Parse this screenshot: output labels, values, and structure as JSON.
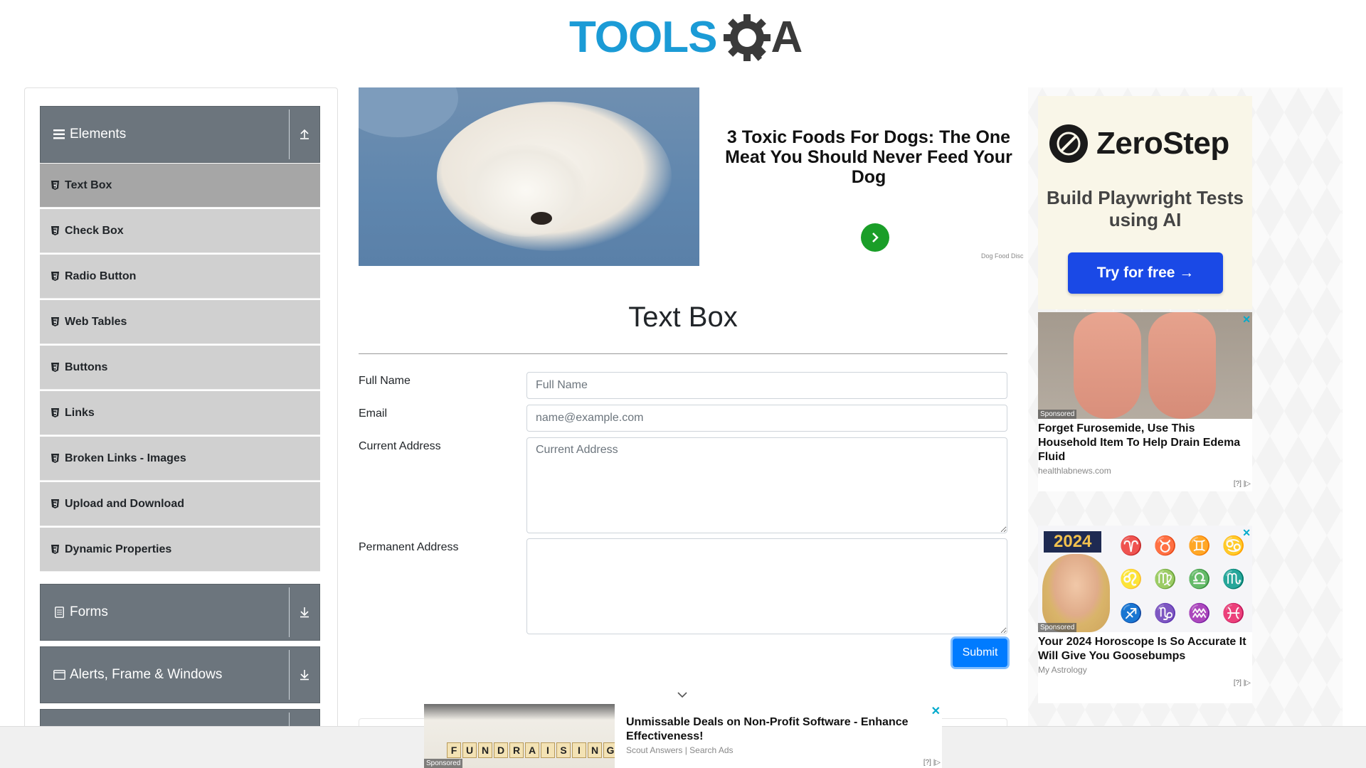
{
  "header": {
    "logo_text": "TOOLS",
    "logo_letter": "A"
  },
  "sidebar": {
    "groups": [
      {
        "label": "Elements",
        "icon": "hamburger-icon",
        "toggle_icon": "collapse-up-icon"
      },
      {
        "label": "Forms",
        "icon": "form-icon",
        "toggle_icon": "expand-down-icon"
      },
      {
        "label": "Alerts, Frame & Windows",
        "icon": "window-icon",
        "toggle_icon": "expand-down-icon"
      }
    ],
    "items": [
      {
        "label": "Text Box",
        "active": true
      },
      {
        "label": "Check Box"
      },
      {
        "label": "Radio Button"
      },
      {
        "label": "Web Tables"
      },
      {
        "label": "Buttons"
      },
      {
        "label": "Links"
      },
      {
        "label": "Broken Links - Images"
      },
      {
        "label": "Upload and Download"
      },
      {
        "label": "Dynamic Properties"
      }
    ]
  },
  "top_ad": {
    "headline": "3 Toxic Foods For Dogs: The One Meat You Should Never Feed Your Dog",
    "source": "Dog Food Disc"
  },
  "page": {
    "title": "Text Box"
  },
  "form": {
    "full_name": {
      "label": "Full Name",
      "placeholder": "Full Name",
      "value": ""
    },
    "email": {
      "label": "Email",
      "placeholder": "name@example.com",
      "value": ""
    },
    "current_address": {
      "label": "Current Address",
      "placeholder": "Current Address",
      "value": ""
    },
    "permanent_address": {
      "label": "Permanent Address",
      "placeholder": "",
      "value": ""
    },
    "submit_label": "Submit"
  },
  "right_ads": {
    "zerostep": {
      "brand": "ZeroStep",
      "tagline": "Build Playwright Tests using AI",
      "cta": "Try for free →"
    },
    "ad1": {
      "badge": "Sponsored",
      "title": "Forget Furosemide, Use This Household Item To Help Drain Edema Fluid",
      "source": "healthlabnews.com",
      "meta": "[?] |▷"
    },
    "ad2": {
      "badge": "Sponsored",
      "year": "2024",
      "title": "Your 2024 Horoscope Is So Accurate It Will Give You Goosebumps",
      "source": "My Astrology",
      "meta": "[?] |▷",
      "sign_labels": [
        "Aries",
        "Taurus",
        "Gemini",
        "Cancer",
        "Leo",
        "Virgo",
        "Libra",
        "Scorpio"
      ]
    }
  },
  "bottom_ad": {
    "badge": "Sponsored",
    "tiles": [
      "F",
      "U",
      "N",
      "D",
      "R",
      "A",
      "I",
      "S",
      "I",
      "N",
      "G"
    ],
    "title": "Unmissable Deals on Non-Profit Software - Enhance Effectiveness!",
    "source": "Scout Answers | Search Ads",
    "meta": "[?] |▷"
  },
  "colors": {
    "brand_blue": "#1b9bd6",
    "sidebar_header": "#6c757d",
    "active_item": "#a6a6a6",
    "item_bg": "#d0d0d0",
    "submit": "#007bff",
    "ad_go": "#1a9e28",
    "zerostep_btn": "#1a49e6"
  }
}
